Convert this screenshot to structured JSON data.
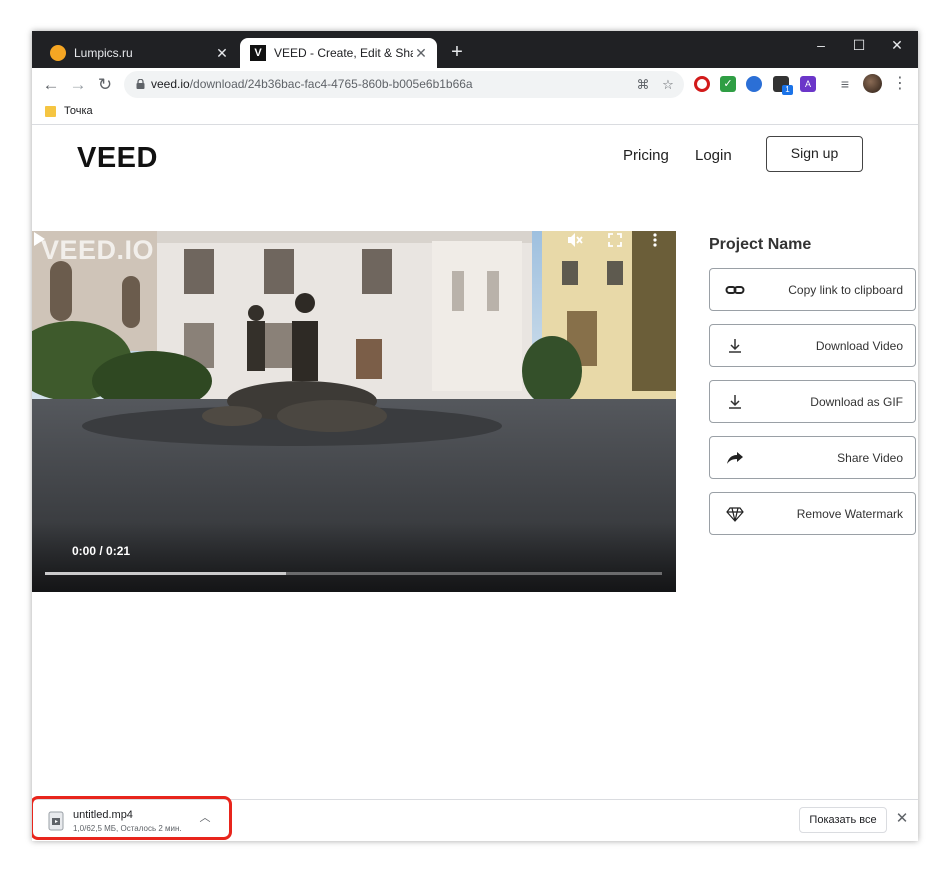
{
  "browser": {
    "tabs": [
      {
        "title": "Lumpics.ru",
        "favicon": "lumpics-orange-circle",
        "active": false
      },
      {
        "title": "VEED - Create, Edit & Share Vide",
        "favicon_text": "V",
        "active": true
      }
    ],
    "new_tab_symbol": "+",
    "window_controls": {
      "minimize": "–",
      "maximize": "☐",
      "close": "✕"
    },
    "nav": {
      "back": "←",
      "forward": "→",
      "reload": "↻"
    },
    "url": {
      "host": "veed.io",
      "path": "/download/24b36bac-fac4-4765-860b-b005e6b1b66a"
    },
    "bookmarks": [
      {
        "label": "Точка",
        "icon": "folder-icon"
      }
    ],
    "extension_badge": "1"
  },
  "page": {
    "logo": "VEED",
    "nav": {
      "pricing": "Pricing",
      "login": "Login",
      "signup": "Sign up"
    },
    "video": {
      "watermark": "VEED.IO",
      "timecode": "0:00 / 0:21",
      "buffered_fraction": 0.39
    },
    "project_name": "Project Name",
    "actions": [
      {
        "label": "Copy link to clipboard",
        "icon": "link-icon"
      },
      {
        "label": "Download Video",
        "icon": "download-icon"
      },
      {
        "label": "Download as GIF",
        "icon": "download-icon"
      },
      {
        "label": "Share Video",
        "icon": "share-icon"
      },
      {
        "label": "Remove Watermark",
        "icon": "diamond-icon"
      }
    ]
  },
  "download_bar": {
    "file_name": "untitled.mp4",
    "status": "1,0/62,5 МБ, Осталось 2 мин.",
    "show_all": "Показать все",
    "highlight_color": "#e8251c"
  }
}
